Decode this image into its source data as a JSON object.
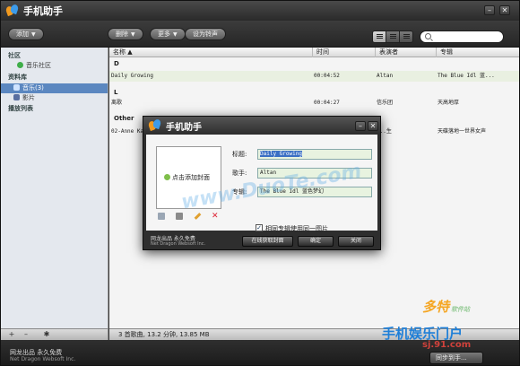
{
  "app": {
    "title": "手机助手"
  },
  "window_controls": {
    "minimize": "–",
    "close": "✕"
  },
  "toolbar": {
    "add_label": "添加",
    "delete_label": "删除",
    "more_label": "更多",
    "set_ringtone_label": "设为铃声"
  },
  "sidebar": {
    "community_header": "社区",
    "music_community": "音乐社区",
    "library_header": "资料库",
    "music_item": "音乐(3)",
    "video_item": "影片",
    "playlist_header": "播放列表"
  },
  "sidebar_bottom": {
    "add": "+",
    "remove": "–",
    "settings": "✱"
  },
  "table": {
    "columns": [
      "名称 ▲",
      "时间",
      "表演者",
      "专辑"
    ],
    "groups": [
      {
        "label": "D",
        "rows": [
          {
            "name": "Daily Growing",
            "time": "00:04:52",
            "artist": "Altan",
            "album": "The Blue Idl 蓝..."
          }
        ]
      },
      {
        "label": "L",
        "rows": [
          {
            "name": "离歌",
            "time": "00:04:27",
            "artist": "信乐团",
            "album": "天高地厚"
          }
        ]
      },
      {
        "label": "Other",
        "rows": [
          {
            "name": "02-Anne Ka...",
            "time": "",
            "artist": "...生",
            "album": "天碟落地一世界女声"
          }
        ]
      }
    ]
  },
  "status": {
    "text": "3 首歌曲, 13.2 分钟, 13.85 MB"
  },
  "footer": {
    "line1": "网龙出品 永久免费",
    "line2": "Net Dragon Websoft Inc."
  },
  "sync_button": {
    "label": "同步到手..."
  },
  "dialog": {
    "title": "手机助手",
    "cover_add": "点击添加封面",
    "title_label": "标题:",
    "title_value": "Daily Growing",
    "singer_label": "歌手:",
    "singer_value": "Altan",
    "album_label": "专辑:",
    "album_value": "The Blue Idl 蓝色梦幻",
    "same_cover_label": "相同专辑使用同一图片",
    "same_cover_checked": "✓",
    "footer_line1": "网龙出品 永久免费",
    "footer_line2": "Net Dragon Websoft Inc.",
    "online_cover_button": "在线获取封面",
    "ok_button": "确定",
    "close_button": "关闭"
  },
  "watermarks": {
    "center": "www.DuoTe.com",
    "brand": "多特",
    "brand_sub": "软件站",
    "portal": "手机娱乐门户",
    "site": "sj.91.com"
  },
  "colors": {
    "selection": "#5b87c0",
    "accent_orange": "#f29a1f",
    "accent_blue": "#3d9be9"
  }
}
